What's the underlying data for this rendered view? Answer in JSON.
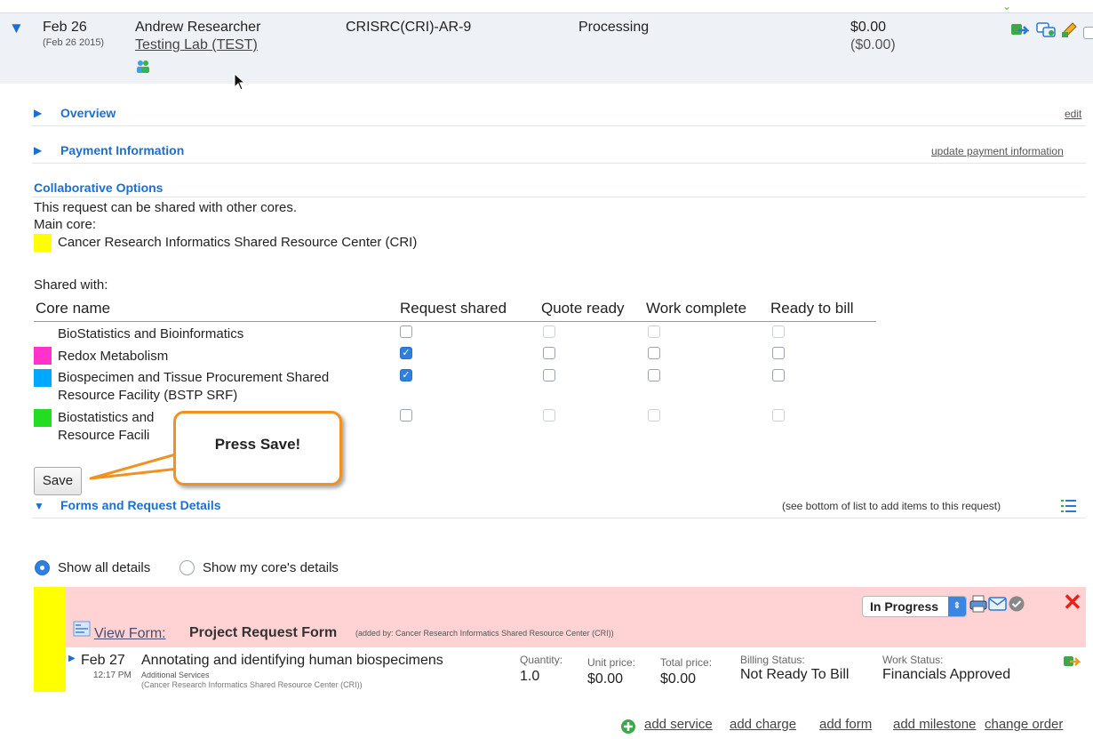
{
  "request": {
    "date": "Feb 26",
    "full_date": "(Feb 26 2015)",
    "requester": "Andrew Researcher",
    "lab": "Testing Lab (TEST)",
    "id": "CRISRC(CRI)-AR-9",
    "status": "Processing",
    "amount": "$0.00",
    "amount_paren": "($0.00)"
  },
  "sections": {
    "overview": "Overview",
    "overview_edit": "edit",
    "payment": "Payment Information",
    "payment_link": "update payment information",
    "collab_title": "Collaborative Options",
    "collab_desc": "This request can be shared with other cores.",
    "main_core_label": "Main core:",
    "main_core": "Cancer Research Informatics Shared Resource Center (CRI)",
    "shared_with": "Shared with:"
  },
  "share_table": {
    "headers": [
      "Core name",
      "Request shared",
      "Quote ready",
      "Work complete",
      "Ready to bill"
    ],
    "rows": [
      {
        "name": "BioStatistics and Bioinformatics",
        "name2": "",
        "color": "",
        "request_shared": false
      },
      {
        "name": "Redox Metabolism",
        "name2": "",
        "color": "#ff33cc",
        "request_shared": true
      },
      {
        "name": "Biospecimen and Tissue Procurement Shared",
        "name2": "Resource Facility (BSTP SRF)",
        "color": "#00a8ff",
        "request_shared": true
      },
      {
        "name": "Biostatistics and",
        "name2": "Resource Facili",
        "color": "#22dd22",
        "request_shared": false
      }
    ]
  },
  "main_core_color": "#ffff00",
  "save_label": "Save",
  "callout_text": "Press Save!",
  "forms": {
    "title": "Forms and Request Details",
    "hint": "(see bottom of list to add items to this request)",
    "show_all": "Show all details",
    "show_mine": "Show my core's details",
    "status_select": "In Progress",
    "view_form": "View Form:",
    "form_name": "Project Request Form",
    "added_by": "(added by: Cancer Research Informatics Shared Resource Center (CRI))"
  },
  "item": {
    "date": "Feb 27",
    "time": "12:17 PM",
    "title": "Annotating and identifying human biospecimens",
    "category": "Additional Services",
    "core": "(Cancer Research Informatics Shared Resource Center (CRI))",
    "quantity_label": "Quantity:",
    "quantity": "1.0",
    "unit_price_label": "Unit price:",
    "unit_price": "$0.00",
    "total_price_label": "Total price:",
    "total_price": "$0.00",
    "billing_label": "Billing Status:",
    "billing": "Not Ready To Bill",
    "work_label": "Work Status:",
    "work": "Financials Approved"
  },
  "bottom_links": {
    "add_service": "add service",
    "add_charge": "add charge",
    "add_form": "add form",
    "add_milestone": "add milestone",
    "change_order": "change order"
  }
}
